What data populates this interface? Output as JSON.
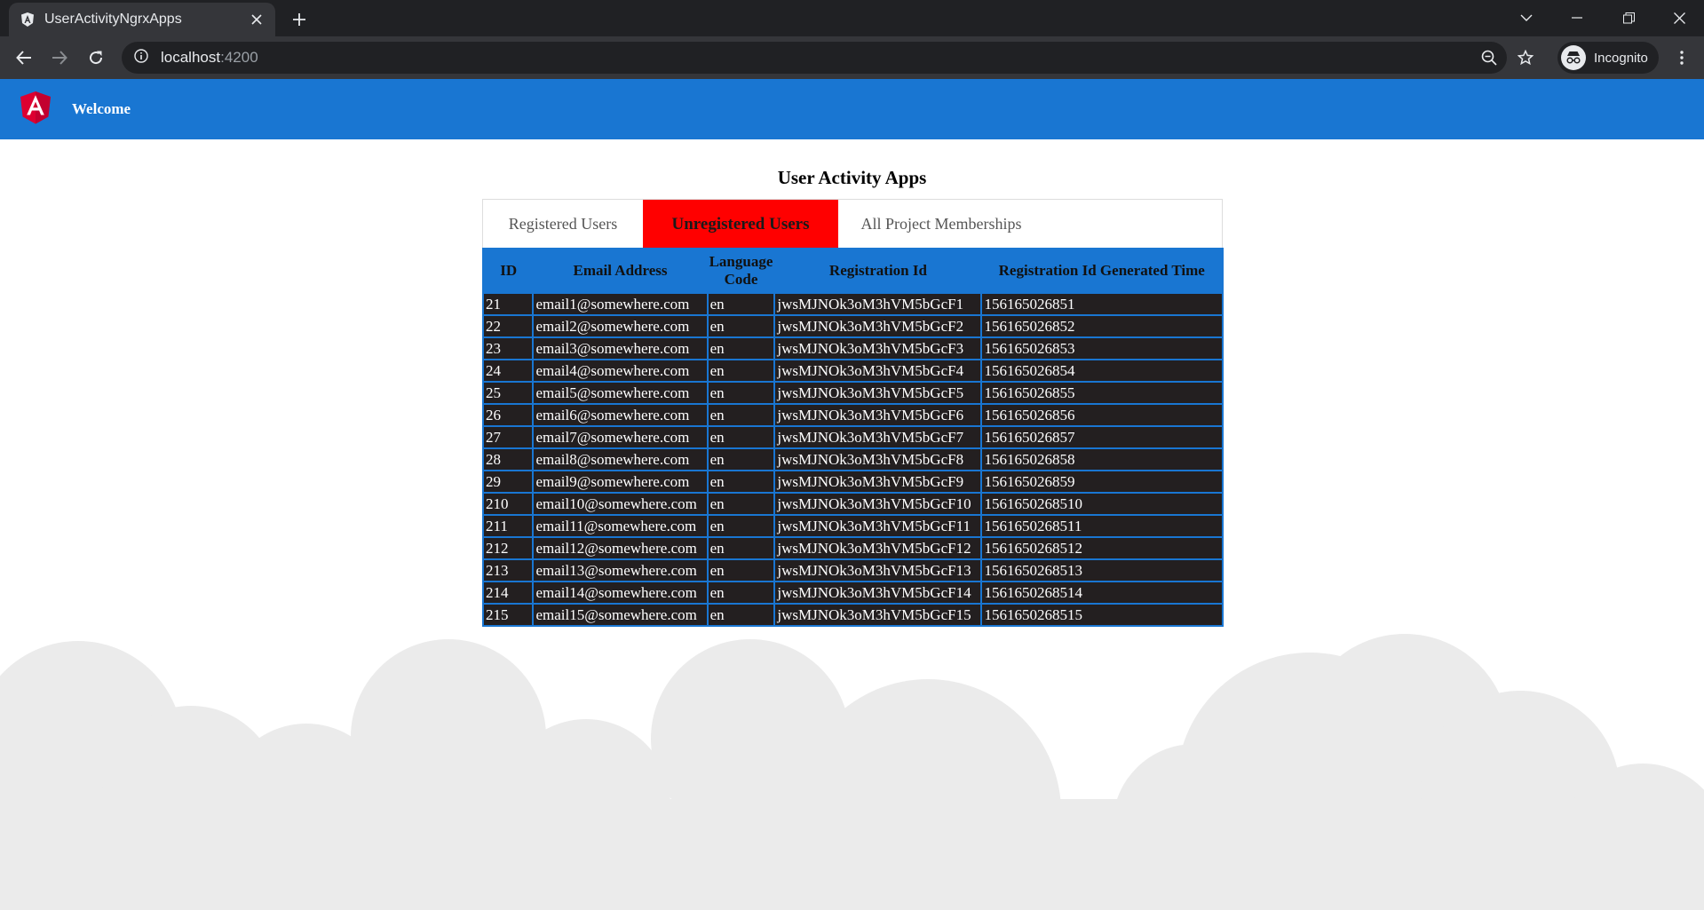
{
  "browser": {
    "tab_title": "UserActivityNgrxApps",
    "url_host": "localhost",
    "url_port": ":4200",
    "profile_label": "Incognito"
  },
  "header": {
    "welcome": "Welcome"
  },
  "page": {
    "title": "User Activity Apps"
  },
  "tabs": [
    {
      "label": "Registered Users",
      "active": false
    },
    {
      "label": "Unregistered Users",
      "active": true
    },
    {
      "label": "All Project Memberships",
      "active": false
    }
  ],
  "table": {
    "headers": [
      "ID",
      "Email Address",
      "Language Code",
      "Registration Id",
      "Registration Id Generated Time"
    ],
    "rows": [
      [
        "21",
        "email1@somewhere.com",
        "en",
        "jwsMJNOk3oM3hVM5bGcF1",
        "156165026851"
      ],
      [
        "22",
        "email2@somewhere.com",
        "en",
        "jwsMJNOk3oM3hVM5bGcF2",
        "156165026852"
      ],
      [
        "23",
        "email3@somewhere.com",
        "en",
        "jwsMJNOk3oM3hVM5bGcF3",
        "156165026853"
      ],
      [
        "24",
        "email4@somewhere.com",
        "en",
        "jwsMJNOk3oM3hVM5bGcF4",
        "156165026854"
      ],
      [
        "25",
        "email5@somewhere.com",
        "en",
        "jwsMJNOk3oM3hVM5bGcF5",
        "156165026855"
      ],
      [
        "26",
        "email6@somewhere.com",
        "en",
        "jwsMJNOk3oM3hVM5bGcF6",
        "156165026856"
      ],
      [
        "27",
        "email7@somewhere.com",
        "en",
        "jwsMJNOk3oM3hVM5bGcF7",
        "156165026857"
      ],
      [
        "28",
        "email8@somewhere.com",
        "en",
        "jwsMJNOk3oM3hVM5bGcF8",
        "156165026858"
      ],
      [
        "29",
        "email9@somewhere.com",
        "en",
        "jwsMJNOk3oM3hVM5bGcF9",
        "156165026859"
      ],
      [
        "210",
        "email10@somewhere.com",
        "en",
        "jwsMJNOk3oM3hVM5bGcF10",
        "1561650268510"
      ],
      [
        "211",
        "email11@somewhere.com",
        "en",
        "jwsMJNOk3oM3hVM5bGcF11",
        "1561650268511"
      ],
      [
        "212",
        "email12@somewhere.com",
        "en",
        "jwsMJNOk3oM3hVM5bGcF12",
        "1561650268512"
      ],
      [
        "213",
        "email13@somewhere.com",
        "en",
        "jwsMJNOk3oM3hVM5bGcF13",
        "1561650268513"
      ],
      [
        "214",
        "email14@somewhere.com",
        "en",
        "jwsMJNOk3oM3hVM5bGcF14",
        "1561650268514"
      ],
      [
        "215",
        "email15@somewhere.com",
        "en",
        "jwsMJNOk3oM3hVM5bGcF15",
        "1561650268515"
      ]
    ]
  },
  "icons": {
    "tab_favicon": "angular-icon",
    "app_logo": "angular-logo-icon"
  },
  "colors": {
    "header_blue": "#1976d2",
    "active_tab_red": "#ff0000",
    "row_background": "#231f20"
  }
}
